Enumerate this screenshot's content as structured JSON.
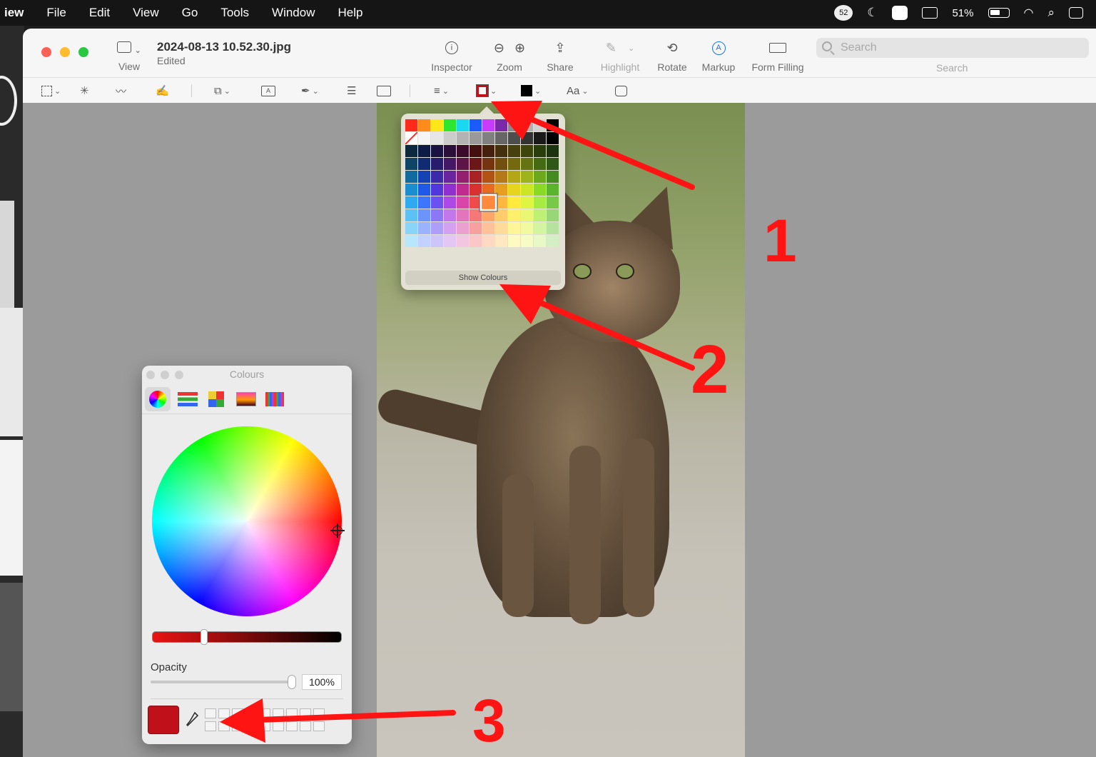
{
  "menubar": {
    "app": "iew",
    "items": [
      "File",
      "Edit",
      "View",
      "Go",
      "Tools",
      "Window",
      "Help"
    ],
    "badge_count": "52",
    "battery": "51%"
  },
  "window": {
    "title": "2024-08-13 10.52.30.jpg",
    "subtitle": "Edited",
    "view_label": "View",
    "toolbar": {
      "inspector": "Inspector",
      "zoom": "Zoom",
      "share": "Share",
      "highlight": "Highlight",
      "rotate": "Rotate",
      "markup": "Markup",
      "form_filling": "Form Filling"
    },
    "search": {
      "placeholder": "Search",
      "label": "Search"
    },
    "markup_tools": {
      "text_style": "Aa"
    }
  },
  "palette_popover": {
    "show_colours": "Show Colours",
    "selected_index": 78,
    "rows": [
      [
        "#ff2a1a",
        "#ff8c1a",
        "#ffe71a",
        "#2ee62e",
        "#1ad8f0",
        "#1a5cff",
        "#c83cff",
        "#7a2aa8",
        "#8a8a8a",
        "#b0b0b0",
        "#d0d0d0",
        "#000000"
      ],
      [
        "#ffffff",
        "#f5f5f5",
        "#e6e6e6",
        "#cccccc",
        "#b3b3b3",
        "#999999",
        "#808080",
        "#666666",
        "#4d4d4d",
        "#333333",
        "#1a1a1a",
        "#000000"
      ],
      [
        "#0c2a3d",
        "#0d1c45",
        "#1a1340",
        "#2a0f3a",
        "#3a0c2a",
        "#42100f",
        "#45200d",
        "#45300d",
        "#45400d",
        "#3d450d",
        "#2a3d0d",
        "#1c330f"
      ],
      [
        "#0e4466",
        "#0f2c73",
        "#271c6b",
        "#451866",
        "#5e1447",
        "#6b1717",
        "#73340f",
        "#734f0f",
        "#736a0f",
        "#657312",
        "#456b12",
        "#2e5718"
      ],
      [
        "#126b9e",
        "#1742b3",
        "#3c2aa8",
        "#6b24a0",
        "#93206e",
        "#a82424",
        "#b35217",
        "#b37a17",
        "#b3a617",
        "#9eb31c",
        "#6ba81c",
        "#478a24"
      ],
      [
        "#1a8fcf",
        "#1f59e6",
        "#5238d9",
        "#8f30cf",
        "#bf2b8f",
        "#d93030",
        "#e66a1f",
        "#e69e1f",
        "#e6d51f",
        "#cce624",
        "#8ad924",
        "#5cb32e"
      ],
      [
        "#2eaaf0",
        "#3d75ff",
        "#6b52f0",
        "#ad4ae6",
        "#d945a8",
        "#f04a4a",
        "#ff8a3d",
        "#ffb83d",
        "#ffea3d",
        "#e0f542",
        "#a6eb42",
        "#78c94a"
      ],
      [
        "#5cc2f5",
        "#6b94ff",
        "#8c78f5",
        "#c278eb",
        "#e375bd",
        "#f57878",
        "#ffa66b",
        "#ffcc6b",
        "#fff06b",
        "#eaf773",
        "#bdf073",
        "#98d678"
      ],
      [
        "#8ad5f7",
        "#99b3ff",
        "#ad9ef7",
        "#d4a0f0",
        "#eba0d0",
        "#f7a0a0",
        "#ffc199",
        "#ffdb99",
        "#fff599",
        "#f2faa0",
        "#d3f5a0",
        "#b7e3a0"
      ],
      [
        "#b8e6fa",
        "#c2d1ff",
        "#cdc4fa",
        "#e4c6f5",
        "#f2c6e0",
        "#fac6c6",
        "#ffd9c2",
        "#ffe8c2",
        "#fff9c2",
        "#f7fcc6",
        "#e6f9c6",
        "#d4eec6"
      ]
    ]
  },
  "colours_panel": {
    "title": "Colours",
    "opacity_label": "Opacity",
    "opacity_value": "100%",
    "opacity_fraction": 1.0,
    "current_colour": "#c0111a"
  },
  "annotations": {
    "one": "1",
    "two": "2",
    "three": "3",
    "color": "#ff1414"
  }
}
